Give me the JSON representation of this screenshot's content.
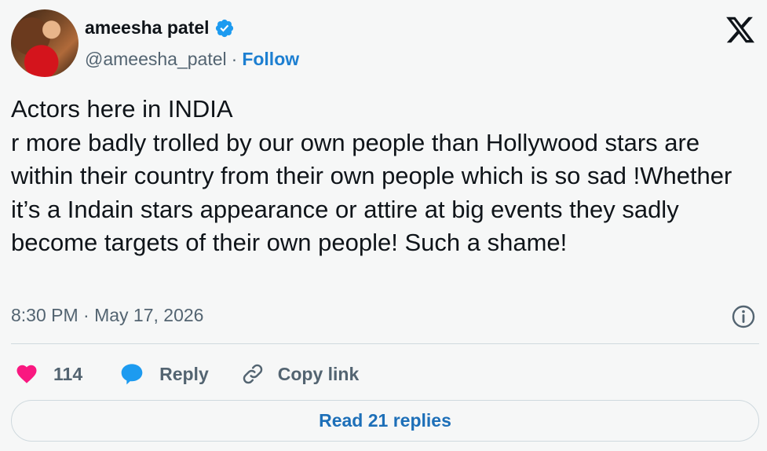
{
  "author": {
    "display_name": "ameesha patel",
    "handle": "@ameesha_patel",
    "separator": "·",
    "follow_label": "Follow",
    "verified_color": "#1d9bf0"
  },
  "tweet": {
    "text": "Actors here in INDIA\nr more badly trolled by our own people than Hollywood stars are within their country from their own people which is so sad !Whether it’s a Indain stars appearance or attire at big events they sadly become targets of their own people! Such a shame!",
    "timestamp": "8:30 PM · May 17, 2026"
  },
  "actions": {
    "like_count": "114",
    "reply_label": "Reply",
    "copy_link_label": "Copy link"
  },
  "footer": {
    "read_replies_label": "Read 21 replies"
  },
  "colors": {
    "like": "#f91880",
    "reply": "#1d9bf0",
    "link": "#1d7fd1"
  },
  "icons": [
    "x-logo-icon",
    "verified-badge-icon",
    "info-icon",
    "heart-icon",
    "reply-bubble-icon",
    "link-icon"
  ]
}
